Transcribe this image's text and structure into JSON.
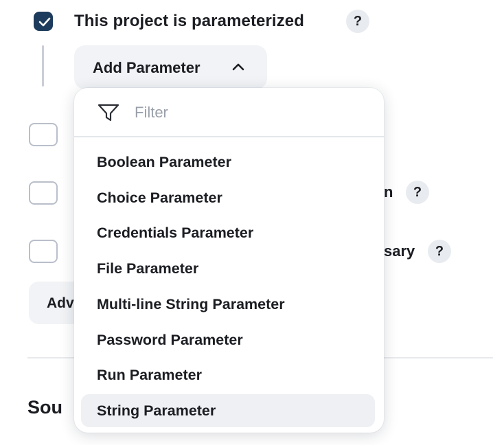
{
  "parameterized": {
    "label": "This project is parameterized",
    "checked": true,
    "help": "?"
  },
  "add_parameter": {
    "label": "Add Parameter"
  },
  "background": {
    "row2_partial": "n",
    "row3_partial": "sary",
    "help": "?",
    "advanced_partial": "Adv",
    "section_partial": "Sou"
  },
  "dropdown": {
    "filter_placeholder": "Filter",
    "items": [
      "Boolean Parameter",
      "Choice Parameter",
      "Credentials Parameter",
      "File Parameter",
      "Multi-line String Parameter",
      "Password Parameter",
      "Run Parameter",
      "String Parameter"
    ],
    "highlighted_index": 7
  },
  "colors": {
    "checkbox_checked": "#1d3b5c",
    "button_bg": "#f1f3f6",
    "highlight_bg": "#eef0f4"
  }
}
